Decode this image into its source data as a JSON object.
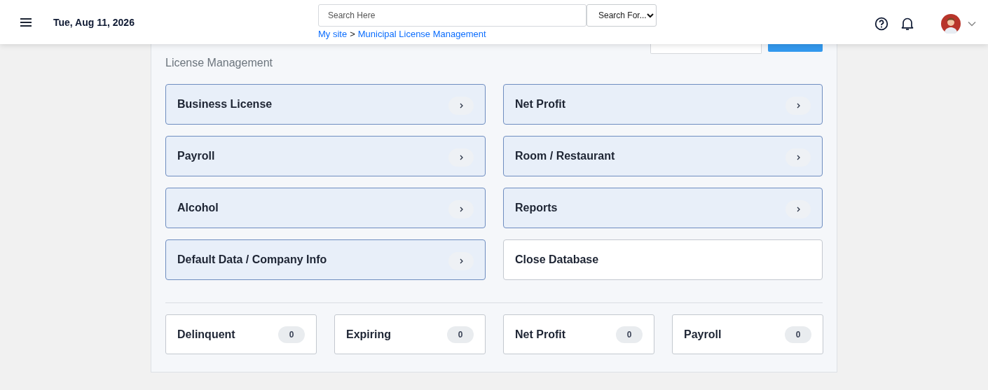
{
  "header": {
    "date": "Tue, Aug 11, 2026",
    "search": {
      "placeholder": "Search Here"
    },
    "search_scope": "Search For...",
    "breadcrumb": [
      "My site",
      "Municipal License Management"
    ],
    "breadcrumb_separator": ">"
  },
  "main_menu": {
    "subtitle": "License Management",
    "items": [
      {
        "label": "Business License",
        "kind": "link"
      },
      {
        "label": "Net Profit",
        "kind": "link"
      },
      {
        "label": "Payroll",
        "kind": "link"
      },
      {
        "label": "Room / Restaurant",
        "kind": "link"
      },
      {
        "label": "Alcohol",
        "kind": "link"
      },
      {
        "label": "Reports",
        "kind": "link"
      },
      {
        "label": "Default Data / Company Info",
        "kind": "link"
      },
      {
        "label": "Close Database",
        "kind": "action"
      }
    ],
    "counters": [
      {
        "label": "Delinquent",
        "count": "0"
      },
      {
        "label": "Expiring",
        "count": "0"
      },
      {
        "label": "Net Profit",
        "count": "0"
      },
      {
        "label": "Payroll",
        "count": "0"
      }
    ]
  }
}
